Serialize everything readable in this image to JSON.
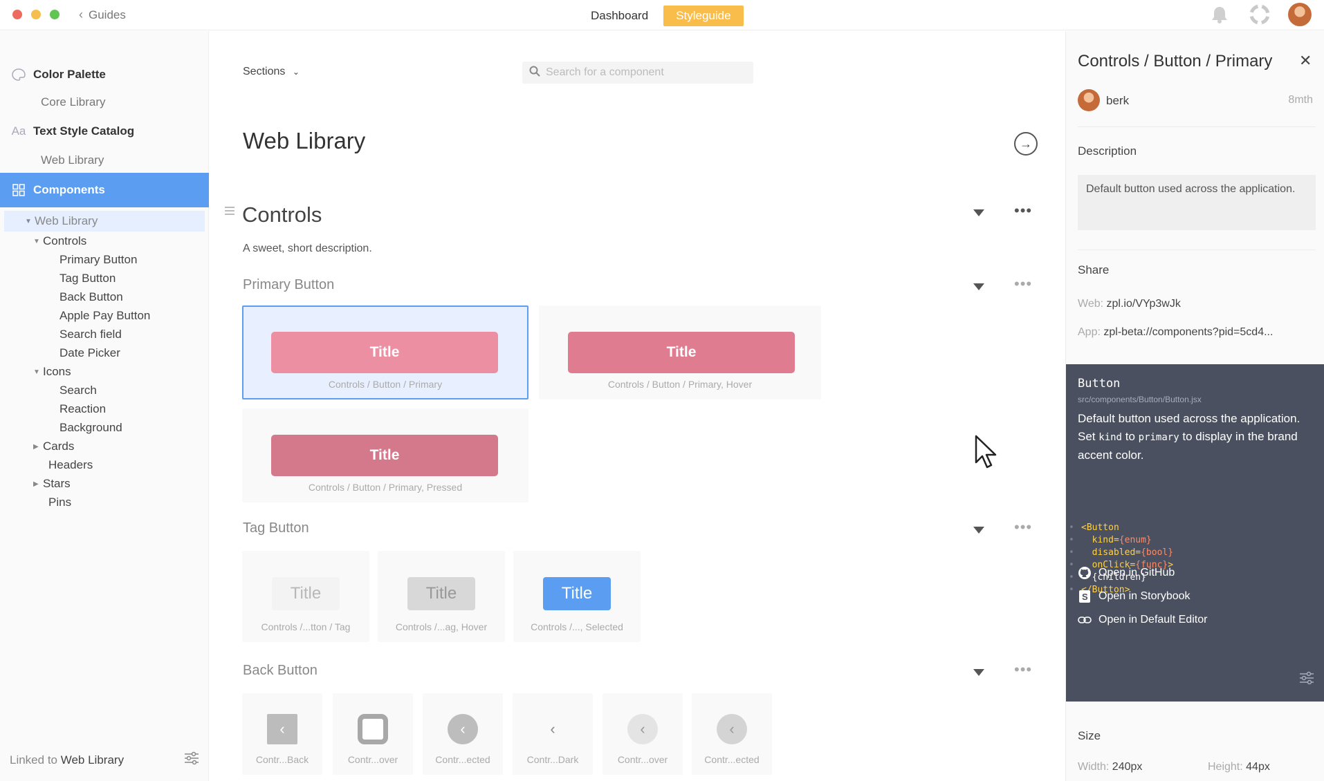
{
  "titlebar": {
    "back_label": "Guides",
    "tabs": [
      {
        "label": "Dashboard",
        "active": false
      },
      {
        "label": "Styleguide",
        "active": true
      }
    ],
    "accent": "#f8bd4a"
  },
  "sidebar": {
    "color_palette": "Color Palette",
    "core_library": "Core Library",
    "text_style_catalog": "Text Style Catalog",
    "text_style_icon": "Aa",
    "web_library_1": "Web Library",
    "components": "Components",
    "web_library_selected": "Web Library",
    "tree": [
      {
        "label": "Controls",
        "level": 1,
        "expanded": true
      },
      {
        "label": "Primary Button",
        "level": 2
      },
      {
        "label": "Tag Button",
        "level": 2
      },
      {
        "label": "Back Button",
        "level": 2
      },
      {
        "label": "Apple Pay Button",
        "level": 2
      },
      {
        "label": "Search field",
        "level": 2
      },
      {
        "label": "Date Picker",
        "level": 2
      },
      {
        "label": "Icons",
        "level": 1,
        "expanded": true
      },
      {
        "label": "Search",
        "level": 2
      },
      {
        "label": "Reaction",
        "level": 2
      },
      {
        "label": "Background",
        "level": 2
      },
      {
        "label": "Cards",
        "level": 1,
        "expanded": false
      },
      {
        "label": "Headers",
        "level": 1
      },
      {
        "label": "Stars",
        "level": 1,
        "expanded": false
      },
      {
        "label": "Pins",
        "level": 1
      }
    ],
    "footer_prefix": "Linked to",
    "footer_library": "Web Library",
    "active_color": "#5b9df0"
  },
  "main": {
    "sections_label": "Sections",
    "search_placeholder": "Search for a component",
    "page_title": "Web Library",
    "section_title": "Controls",
    "section_desc": "A sweet, short description.",
    "primary_button": {
      "title": "Primary Button",
      "variants": [
        {
          "label": "Title",
          "caption": "Controls / Button / Primary",
          "color": "#ec8fa3",
          "selected": true
        },
        {
          "label": "Title",
          "caption": "Controls / Button / Primary, Hover",
          "color": "#e07c90",
          "selected": false
        },
        {
          "label": "Title",
          "caption": "Controls / Button / Primary, Pressed",
          "color": "#d4788c",
          "selected": false
        }
      ]
    },
    "tag_button": {
      "title": "Tag Button",
      "variants": [
        {
          "label": "Title",
          "caption": "Controls /...tton / Tag"
        },
        {
          "label": "Title",
          "caption": "Controls /...ag, Hover"
        },
        {
          "label": "Title",
          "caption": "Controls /..., Selected"
        }
      ]
    },
    "back_button": {
      "title": "Back Button",
      "variants": [
        {
          "caption": "Contr...Back"
        },
        {
          "caption": "Contr...over"
        },
        {
          "caption": "Contr...ected"
        },
        {
          "caption": "Contr...Dark"
        },
        {
          "caption": "Contr...over"
        },
        {
          "caption": "Contr...ected"
        }
      ]
    }
  },
  "panel": {
    "title": "Controls / Button / Primary",
    "user": "berk",
    "age": "8mth",
    "description_label": "Description",
    "description": "Default button used across the application.",
    "share_label": "Share",
    "web_label": "Web:",
    "web_url": "zpl.io/VYp3wJk",
    "app_label": "App:",
    "app_url": "zpl-beta://components?pid=5cd4...",
    "code": {
      "component": "Button",
      "path": "src/components/Button/Button.jsx",
      "desc_line1": "Default button used across the application.",
      "desc_set": "Set",
      "desc_kind": "kind",
      "desc_to": "to",
      "desc_primary": "primary",
      "desc_tail": "to display in the brand accent color.",
      "lines": [
        {
          "a": "<Button",
          "b": "",
          "c": ""
        },
        {
          "a": "  kind=",
          "b": "{enum}",
          "c": ""
        },
        {
          "a": "  disabled=",
          "b": "{bool}",
          "c": ""
        },
        {
          "a": "  onClick=",
          "b": "{func}",
          "c": ">"
        },
        {
          "a": "",
          "b": "",
          "c": "  {children}"
        },
        {
          "a": "</Button>",
          "b": "",
          "c": ""
        }
      ],
      "links": [
        "Open in GitHub",
        "Open in Storybook",
        "Open in Default Editor"
      ]
    },
    "size_label": "Size",
    "width_label": "Width:",
    "width_value": "240px",
    "height_label": "Height:",
    "height_value": "44px"
  }
}
